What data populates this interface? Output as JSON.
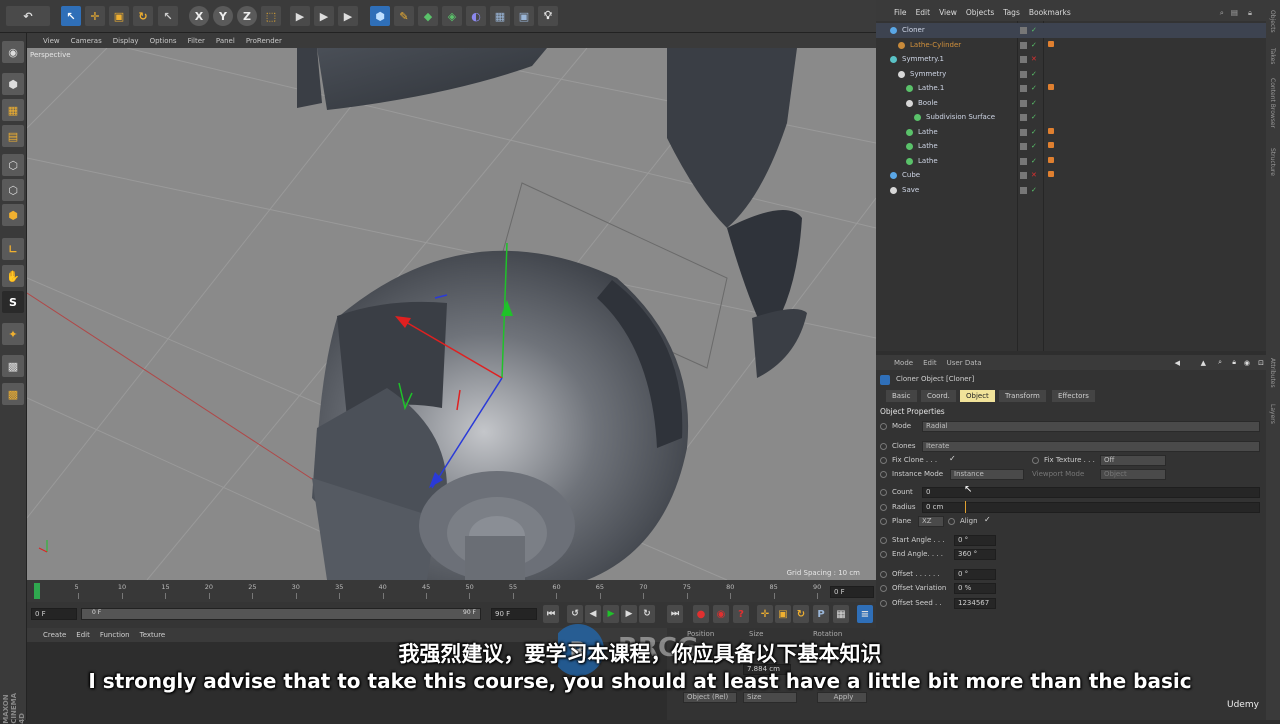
{
  "viewport": {
    "menu": [
      "View",
      "Cameras",
      "Display",
      "Options",
      "Filter",
      "Panel",
      "ProRender"
    ],
    "label": "Perspective",
    "grid_spacing": "Grid Spacing : 10 cm"
  },
  "timeline": {
    "ticks": [
      "0",
      "5",
      "10",
      "15",
      "20",
      "25",
      "30",
      "35",
      "40",
      "45",
      "50",
      "55",
      "60",
      "65",
      "70",
      "75",
      "80",
      "85",
      "90"
    ],
    "frame_end_field": "0 F",
    "start_field": "0 F",
    "min_field": "0 F",
    "max_field": "90 F",
    "end_field": "90 F"
  },
  "materials": {
    "menu": [
      "Create",
      "Edit",
      "Function",
      "Texture"
    ]
  },
  "coords": {
    "headers": [
      "Position",
      "Size",
      "Rotation"
    ],
    "size_x": "7.884 cm",
    "mode_drop": "Object (Rel)",
    "size_drop": "Size",
    "apply_label": "Apply"
  },
  "object_manager": {
    "menu": [
      "File",
      "Edit",
      "View",
      "Objects",
      "Tags",
      "Bookmarks"
    ],
    "objects": [
      {
        "name": "Cloner",
        "indent": 0,
        "color": "#5aa7e6",
        "active": true
      },
      {
        "name": "Lathe-Cylinder",
        "indent": 1,
        "color": "#c88a3a",
        "active": false
      },
      {
        "name": "Symmetry.1",
        "indent": 0,
        "color": "#5ac2c6",
        "active": false
      },
      {
        "name": "Symmetry",
        "indent": 1,
        "color": "#d7d7d7",
        "active": false
      },
      {
        "name": "Lathe.1",
        "indent": 2,
        "color": "#5ac26a",
        "active": false
      },
      {
        "name": "Boole",
        "indent": 2,
        "color": "#d7d7d7",
        "active": false
      },
      {
        "name": "Subdivision Surface",
        "indent": 3,
        "color": "#5ac26a",
        "active": false
      },
      {
        "name": "Lathe",
        "indent": 2,
        "color": "#5ac26a",
        "active": false
      },
      {
        "name": "Lathe",
        "indent": 2,
        "color": "#5ac26a",
        "active": false
      },
      {
        "name": "Lathe",
        "indent": 2,
        "color": "#5ac26a",
        "active": false
      },
      {
        "name": "Cube",
        "indent": 0,
        "color": "#5aa7e6",
        "active": false
      },
      {
        "name": "Save",
        "indent": 0,
        "color": "#d7d7d7",
        "active": false
      }
    ]
  },
  "attributes": {
    "menu": [
      "Mode",
      "Edit",
      "User Data"
    ],
    "title": "Cloner Object [Cloner]",
    "tabs": [
      "Basic",
      "Coord.",
      "Object",
      "Transform",
      "Effectors"
    ],
    "active_tab": "Object",
    "section": "Object Properties",
    "mode_label": "Mode",
    "mode_value": "Radial",
    "clones_label": "Clones",
    "clones_value": "Iterate",
    "fix_clone_label": "Fix Clone . . .",
    "fix_texture_label": "Fix Texture . . .",
    "fix_texture_value": "Off",
    "instance_mode_label": "Instance Mode",
    "instance_mode_value": "Instance",
    "viewport_mode_label": "Viewport Mode",
    "viewport_mode_value": "Object",
    "count_label": "Count",
    "count_value": "0",
    "radius_label": "Radius",
    "radius_value": "0 cm",
    "plane_label": "Plane",
    "plane_value": "XZ",
    "align_label": "Align",
    "start_angle_label": "Start Angle . . .",
    "start_angle_value": "0 °",
    "end_angle_label": "End Angle. . . .",
    "end_angle_value": "360 °",
    "offset_label": "Offset . . . . . .",
    "offset_value": "0 °",
    "offset_variation_label": "Offset Variation",
    "offset_variation_value": "0 %",
    "offset_seed_label": "Offset Seed . .",
    "offset_seed_value": "1234567"
  },
  "right_strip_tabs": [
    "Objects",
    "Takes",
    "Content Browser",
    "Structure",
    "Attributes",
    "Layers"
  ],
  "subtitles": {
    "chinese": "我强烈建议，要学习本课程，你应具备以下基本知识",
    "english": "I strongly advise that to take this course, you should at least have a little bit more than the basic"
  },
  "branding": {
    "udemy": "Udemy",
    "maxon": "MAXON CINEMA 4D",
    "watermark": "RRCG 人人素材"
  },
  "colors": {
    "accent_tab": "#f1e39a",
    "cloner_blue": "#5aa7e6",
    "axis_red": "#e02020",
    "axis_green": "#1fc22a",
    "axis_blue": "#2a3ad8"
  }
}
